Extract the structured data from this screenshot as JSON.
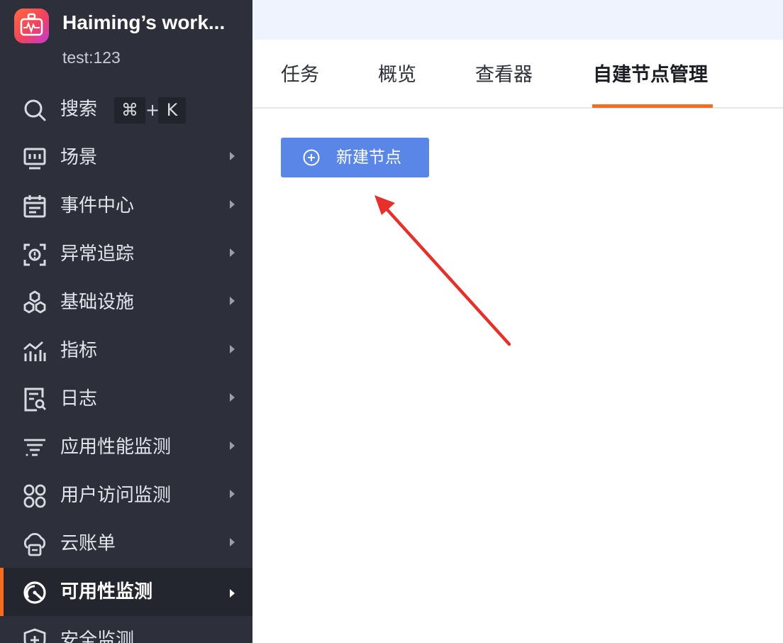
{
  "workspace": {
    "name": "Haiming’s work...",
    "subtitle": "test:123"
  },
  "sidebar": {
    "search": {
      "label": "搜索",
      "shortcut_cmd": "⌘",
      "shortcut_plus": "+",
      "shortcut_key": "K",
      "icon": "search-icon"
    },
    "items": [
      {
        "label": "场景",
        "icon": "scene-icon"
      },
      {
        "label": "事件中心",
        "icon": "calendar-icon"
      },
      {
        "label": "异常追踪",
        "icon": "bug-scan-icon"
      },
      {
        "label": "基础设施",
        "icon": "hexagon-cluster-icon"
      },
      {
        "label": "指标",
        "icon": "chart-icon"
      },
      {
        "label": "日志",
        "icon": "log-search-icon"
      },
      {
        "label": "应用性能监测",
        "icon": "filter-lines-icon"
      },
      {
        "label": "用户访问监测",
        "icon": "grid-circles-icon"
      },
      {
        "label": "云账单",
        "icon": "cloud-bill-icon"
      },
      {
        "label": "可用性监测",
        "icon": "gauge-icon",
        "active": true
      },
      {
        "label": "安全监测",
        "icon": "shield-icon"
      }
    ]
  },
  "tabs": [
    {
      "label": "任务"
    },
    {
      "label": "概览"
    },
    {
      "label": "查看器"
    },
    {
      "label": "自建节点管理",
      "active": true
    }
  ],
  "toolbar": {
    "new_node_label": "新建节点",
    "new_node_icon": "plus-circle-icon"
  },
  "colors": {
    "sidebar_bg": "#2d2f3a",
    "accent": "#f86c1b",
    "button_bg": "#5a86e8",
    "topbar_bg": "#eef3fe",
    "annotation_arrow": "#e8302a"
  }
}
